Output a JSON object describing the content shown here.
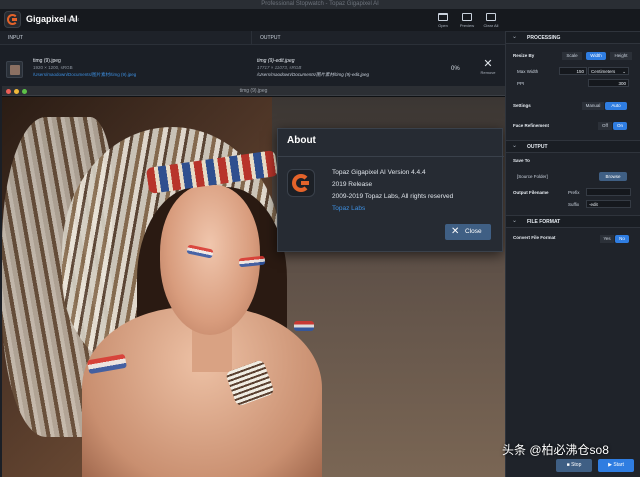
{
  "window": {
    "title": "Professional Stopwatch - Topaz Gigapixel AI"
  },
  "app": {
    "name": "Gigapixel AI",
    "version": "v4.4.4"
  },
  "toolbar": {
    "open": "Open",
    "preview": "Preview",
    "clear_all": "Clear All"
  },
  "columns": {
    "input": "INPUT",
    "output": "OUTPUT"
  },
  "file": {
    "name": "timg (9).jpeg",
    "dims": "1920 × 1200, sRGB",
    "path": "/Users/maodown/Documents/图片素材/timg (9).jpeg",
    "out_name": "timg (9)-edit.jpeg",
    "out_dims": "17717 × 11073, sRGB",
    "out_path": "/Users/maodown/Documents/图片素材/timg (9)-edit.jpeg",
    "progress": "0%",
    "remove": "Remove"
  },
  "preview": {
    "title": "timg (9).jpeg"
  },
  "about": {
    "title": "About",
    "version": "Topaz Gigapixel AI Version 4.4.4",
    "release": "2019 Release",
    "copyright": "2009-2019 Topaz Labs, All rights reserved",
    "link": "Topaz Labs",
    "close": "Close"
  },
  "processing": {
    "header": "PROCESSING",
    "resize_by": "Resize By",
    "scale": "Scale",
    "width": "Width",
    "height": "Height",
    "max_width_label": "Max Width",
    "max_width": "150",
    "unit": "Centimeters",
    "ppi_label": "PPI",
    "ppi": "300",
    "settings_label": "Settings",
    "manual": "Manual",
    "auto": "Auto",
    "face_label": "Face Refinement",
    "off": "Off",
    "on": "On"
  },
  "output": {
    "header": "OUTPUT",
    "save_to": "Save To",
    "folder": "[Source Folder]",
    "browse": "Browse",
    "filename_label": "Output Filename",
    "prefix_label": "Prefix",
    "prefix": "",
    "suffix_label": "Suffix",
    "suffix": "-edit"
  },
  "file_format": {
    "header": "FILE FORMAT",
    "convert_label": "Convert File Format",
    "yes": "Yes",
    "no": "No"
  },
  "actions": {
    "stop": "Stop",
    "start": "Start"
  },
  "watermark": "头条 @柏必沸仓so8",
  "colors": {
    "accent": "#2f7de1",
    "brand_orange": "#e4632a",
    "link": "#3d8fe0"
  }
}
